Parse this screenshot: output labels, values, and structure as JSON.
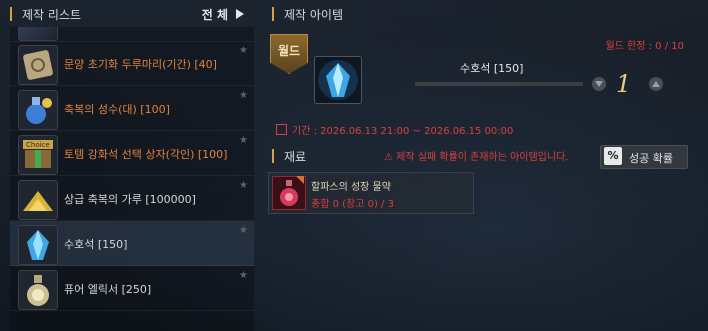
{
  "list_panel": {
    "title": "제작 리스트",
    "filter_label": "전 체",
    "items": [
      {
        "label": "문양 초기화 두루마리(기간) [40]",
        "color": "#e1823c",
        "icon": "scroll-icon"
      },
      {
        "label": "축복의 성수(대) [100]",
        "color": "#e1823c",
        "icon": "holy-water-icon"
      },
      {
        "label": "토템 강화석 선택 상자(각인) [100]",
        "color": "#e1823c",
        "icon": "choice-box-icon"
      },
      {
        "label": "상급 축복의 가루 [100000]",
        "color": "#d4d6d9",
        "icon": "gold-powder-icon"
      },
      {
        "label": "수호석 [150]",
        "color": "#d4d6d9",
        "icon": "blue-crystal-icon"
      },
      {
        "label": "퓨어 엘릭서 [250]",
        "color": "#d4d6d9",
        "icon": "elixir-icon"
      }
    ]
  },
  "craft_panel": {
    "title": "제작 아이템",
    "world_badge": "월드",
    "world_limit": "월드 한정 : 0 / 10",
    "item_name": "수호석 [150]",
    "quantity": "1",
    "period": "기간 : 2026.06.13 21:00 ~ 2026.06.15 00:00"
  },
  "materials": {
    "title": "재료",
    "warning": "제작 실패 확률이 존재하는 아이템입니다.",
    "rate_button_icon": "%",
    "rate_button_label": "성공 확률",
    "items": [
      {
        "name": "할파스의 성장 물약",
        "count": "총합 0 (창고 0) / 3"
      }
    ]
  }
}
